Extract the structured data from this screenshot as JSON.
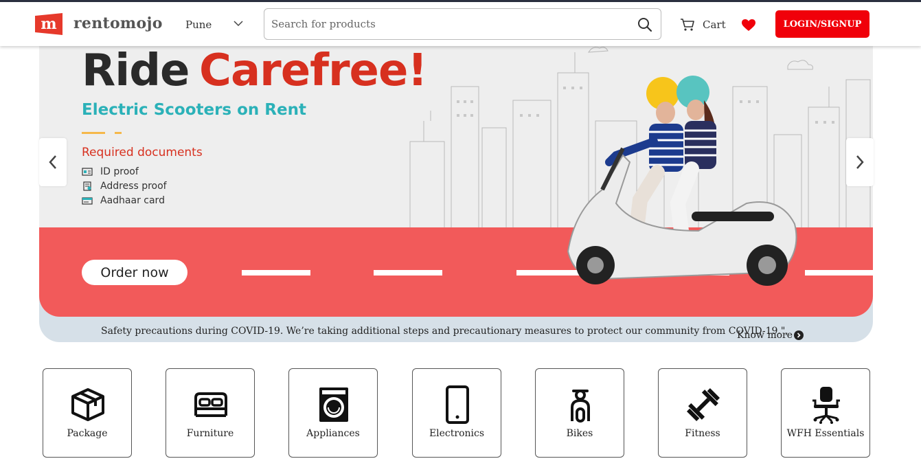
{
  "header": {
    "brand": "rentomojo",
    "city": "Pune",
    "search_placeholder": "Search for products",
    "cart_label": "Cart",
    "login_label": "LOGIN/SIGNUP"
  },
  "banner": {
    "title_part1": "Ride",
    "title_part2": "Carefree!",
    "subtitle": "Electric Scooters on Rent",
    "required_docs_title": "Required documents",
    "docs": [
      "ID proof",
      "Address proof",
      "Aadhaar card"
    ],
    "cta": "Order now",
    "notice": "Safety precautions during COVID-19. We’re taking additional steps and precautionary measures to protect our community from COVID-19.\",",
    "know_more": "Know more"
  },
  "categories": [
    {
      "label": "Package",
      "icon": "box-icon"
    },
    {
      "label": "Furniture",
      "icon": "bed-icon"
    },
    {
      "label": "Appliances",
      "icon": "washing-machine-icon"
    },
    {
      "label": "Electronics",
      "icon": "phone-icon"
    },
    {
      "label": "Bikes",
      "icon": "scooter-icon"
    },
    {
      "label": "Fitness",
      "icon": "dumbbell-icon"
    },
    {
      "label": "WFH Essentials",
      "icon": "office-chair-icon"
    }
  ],
  "colors": {
    "brand_red": "#f0000a",
    "title_red": "#d7301f",
    "teal": "#2bb1b8",
    "road": "#f25a5a",
    "covid_strip": "#d6e0e8"
  }
}
